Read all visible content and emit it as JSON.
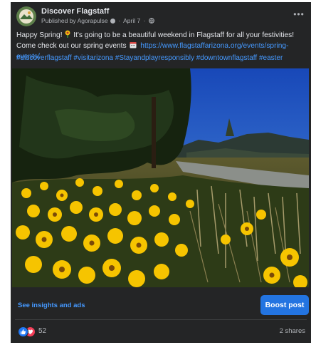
{
  "post": {
    "page_name": "Discover Flagstaff",
    "published_prefix": "Published by",
    "publisher": "Agorapulse",
    "date": "April 7",
    "text_prefix": "Happy Spring!",
    "text_main": "It's going to be a beautiful weekend in Flagstaff for all your festivities! Come check out our spring events",
    "link": "https://www.flagstaffarizona.org/events/spring-events/",
    "hashtags": "#discoverflagstaff #visitarizona #Stayandplayresponsibly #downtownflagstaff #easter"
  },
  "actions": {
    "insights_label": "See insights and ads",
    "boost_label": "Boost post"
  },
  "engagement": {
    "reaction_count": "52",
    "shares_label": "2 shares"
  },
  "icons": {
    "header_menu": "more-icon",
    "privacy": "globe-icon",
    "emoji": "flower-emoji-icon",
    "link_prefix": "calendar-emoji-icon",
    "reactions": [
      "like-reaction-icon",
      "love-reaction-icon"
    ]
  },
  "colors": {
    "card_background": "#242526",
    "link": "#4599ff",
    "boost_button": "#2374e1",
    "like": "#2078f4",
    "love": "#f33e58"
  }
}
